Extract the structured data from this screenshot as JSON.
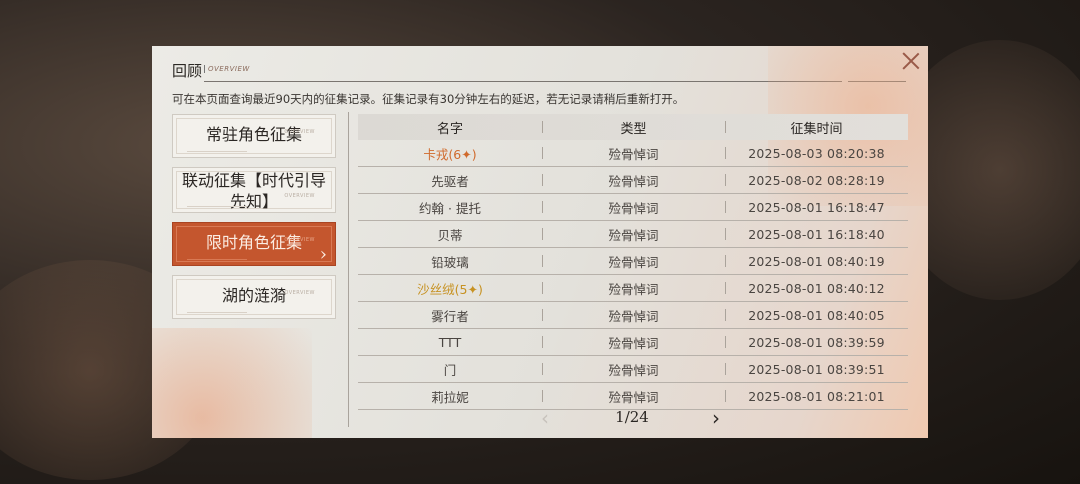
{
  "dialog": {
    "title": "回顾",
    "title_sub": "OVERVIEW",
    "notice": "可在本页面查询最近90天内的征集记录。征集记录有30分钟左右的延迟，若无记录请稍后重新打开。"
  },
  "sidebar": {
    "items": [
      {
        "label": "常驻角色征集",
        "tag": "OVERVIEW",
        "active": false
      },
      {
        "label": "联动征集【时代引导先知】",
        "tag": "OVERVIEW",
        "active": false
      },
      {
        "label": "限时角色征集",
        "tag": "OVERVIEW",
        "active": true
      },
      {
        "label": "湖的涟漪",
        "tag": "OVERVIEW",
        "active": false
      }
    ]
  },
  "table": {
    "headers": [
      "名字",
      "类型",
      "征集时间"
    ],
    "rows": [
      {
        "name": "卡戎(6✦)",
        "type": "殓骨悼词",
        "time": "2025-08-03 08:20:38",
        "rarity": "6"
      },
      {
        "name": "先驱者",
        "type": "殓骨悼词",
        "time": "2025-08-02 08:28:19",
        "rarity": ""
      },
      {
        "name": "约翰 · 提托",
        "type": "殓骨悼词",
        "time": "2025-08-01 16:18:47",
        "rarity": ""
      },
      {
        "name": "贝蒂",
        "type": "殓骨悼词",
        "time": "2025-08-01 16:18:40",
        "rarity": ""
      },
      {
        "name": "铅玻璃",
        "type": "殓骨悼词",
        "time": "2025-08-01 08:40:19",
        "rarity": ""
      },
      {
        "name": "沙丝绒(5✦)",
        "type": "殓骨悼词",
        "time": "2025-08-01 08:40:12",
        "rarity": "5"
      },
      {
        "name": "雾行者",
        "type": "殓骨悼词",
        "time": "2025-08-01 08:40:05",
        "rarity": ""
      },
      {
        "name": "TTT",
        "type": "殓骨悼词",
        "time": "2025-08-01 08:39:59",
        "rarity": ""
      },
      {
        "name": "门",
        "type": "殓骨悼词",
        "time": "2025-08-01 08:39:51",
        "rarity": ""
      },
      {
        "name": "莉拉妮",
        "type": "殓骨悼词",
        "time": "2025-08-01 08:21:01",
        "rarity": ""
      }
    ]
  },
  "pager": {
    "text": "1/24",
    "prev_icon": "‹",
    "next_icon": "›"
  },
  "icons": {
    "close": "close-icon",
    "active_arrow": "chevron-right-icon"
  },
  "colors": {
    "active_tab": "#c4562e",
    "rarity_6": "#d06a2c",
    "rarity_5": "#c79222"
  }
}
